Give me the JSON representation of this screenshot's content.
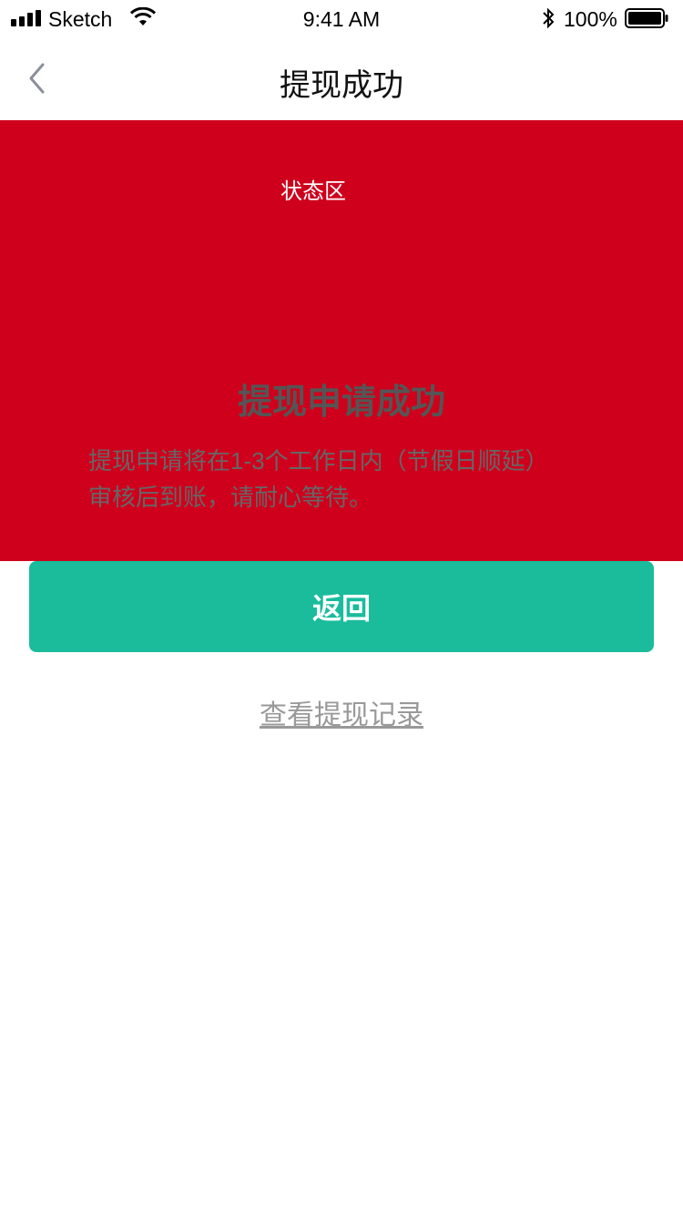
{
  "status_bar": {
    "carrier": "Sketch",
    "time": "9:41 AM",
    "battery_percent": "100%",
    "icons": [
      "signal-icon",
      "wifi-icon",
      "bluetooth-icon",
      "battery-icon"
    ]
  },
  "nav": {
    "title": "提现成功",
    "back_icon": "chevron-left-icon"
  },
  "status_area": {
    "label": "状态区",
    "background_color": "#cf001c",
    "title": "提现申请成功",
    "description_line1": "提现申请将在1-3个工作日内（节假日顺延）",
    "description_line2": "审核后到账，请耐心等待。"
  },
  "actions": {
    "return_label": "返回",
    "return_color": "#1abc9c",
    "records_link": "查看提现记录"
  }
}
